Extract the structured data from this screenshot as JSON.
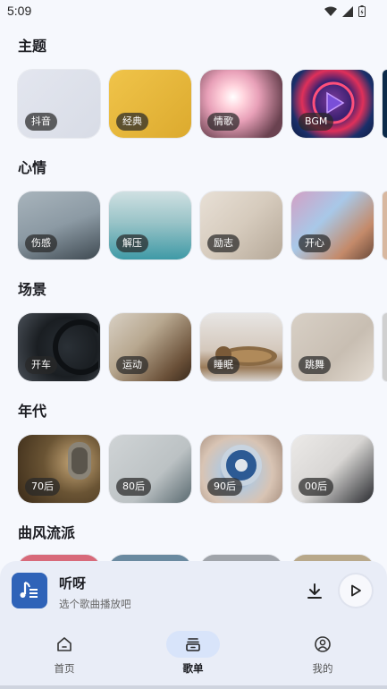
{
  "status": {
    "time": "5:09"
  },
  "sections": [
    {
      "title": "主题",
      "cards": [
        {
          "label": "抖音",
          "bg": "linear-gradient(135deg,#e3e6ef,#d8dce6)"
        },
        {
          "label": "经典",
          "bg": "linear-gradient(135deg,#f0c44a,#dcaa2e)"
        },
        {
          "label": "情歌",
          "bg": "radial-gradient(circle at 40% 40%,#fff 0%,#ffd2dc 18%,#e8a0b8 40%,#6a4250 80%)"
        },
        {
          "label": "BGM",
          "bg": "radial-gradient(circle at 50% 45%,#7c3b9b 0%,#3a2070 35%,#e0305a 55%,#1a2f6a 75%,#0f1c40 100%)"
        }
      ]
    },
    {
      "title": "心情",
      "cards": [
        {
          "label": "伤感",
          "bg": "linear-gradient(160deg,#a8b4bc 0%,#8c9aa4 50%,#3f4a52 100%)"
        },
        {
          "label": "解压",
          "bg": "linear-gradient(180deg,#cfe0e2 0%,#9ac4c8 45%,#3f9aa6 100%)"
        },
        {
          "label": "励志",
          "bg": "linear-gradient(135deg,#e8e0d6 0%,#d6cbbd 50%,#b5a898 100%)"
        },
        {
          "label": "开心",
          "bg": "linear-gradient(135deg,#d3a0c4 0%,#a8c8e8 40%,#c48a6a 75%,#6a4a3a 100%)"
        }
      ]
    },
    {
      "title": "场景",
      "cards": [
        {
          "label": "开车",
          "bg": "radial-gradient(circle at 60% 50%,#2a3036 0%,#1a1e22 50%,#4a5058 100%)"
        },
        {
          "label": "运动",
          "bg": "linear-gradient(135deg,#d8d0c4 0%,#b8a890 40%,#6a5038 80%,#3a2a1c 100%)"
        },
        {
          "label": "睡眠",
          "bg": "linear-gradient(180deg,#e8e6e4 0%,#d4c8bc 55%,#9a7a58 80%,#d8d4d0 100%)"
        },
        {
          "label": "跳舞",
          "bg": "linear-gradient(135deg,#d8d0c6 0%,#c8beb2 60%,#e4dcd2 100%)"
        }
      ]
    },
    {
      "title": "年代",
      "cards": [
        {
          "label": "70后",
          "bg": "radial-gradient(circle at 70% 40%,#c8a878 0%,#6a5434 45%,#3a2a18 100%)"
        },
        {
          "label": "80后",
          "bg": "linear-gradient(135deg,#d0d4d6 0%,#bcc2c4 60%,#5a6a70 100%)"
        },
        {
          "label": "90后",
          "bg": "radial-gradient(circle at 45% 55%,#3a6aa8 0%,#b8c8d8 30%,#d8c4b4 60%,#a08878 100%)"
        },
        {
          "label": "00后",
          "bg": "linear-gradient(135deg,#eceae8 0%,#d8d6d4 50%,#2a2c30 100%)"
        }
      ]
    },
    {
      "title": "曲风流派",
      "cards": []
    }
  ],
  "player": {
    "title": "听呀",
    "subtitle": "选个歌曲播放吧"
  },
  "nav": [
    {
      "label": "首页"
    },
    {
      "label": "歌单"
    },
    {
      "label": "我的"
    }
  ],
  "colors": {
    "accent": "#2f63b8",
    "nav_active_bg": "#d8e4fa"
  }
}
